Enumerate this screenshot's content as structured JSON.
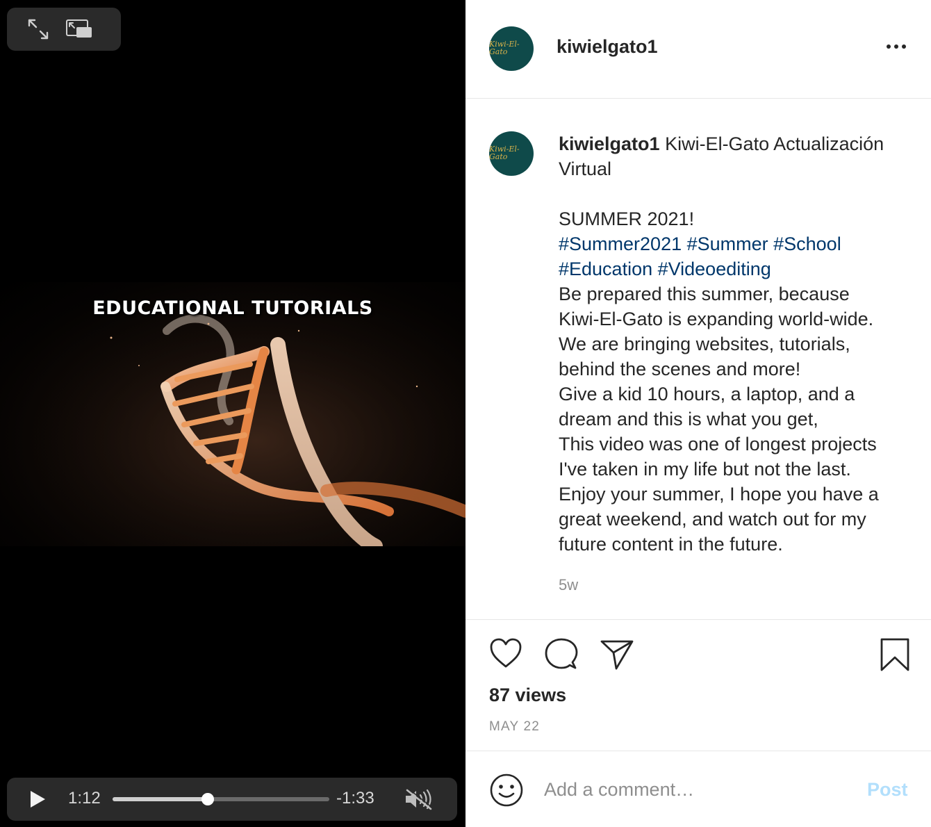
{
  "video": {
    "overlay_title": "Educational Tutorials",
    "time_elapsed": "1:12",
    "time_remaining": "-1:33",
    "progress_fraction": 0.44
  },
  "post": {
    "username": "kiwielgato1",
    "avatar_text": "Kiwi-El-Gato",
    "caption_title": "Kiwi-El-Gato Actualización",
    "caption_title_cont": "Virtual",
    "lines": [
      {
        "type": "text",
        "text": "SUMMER 2021!"
      },
      {
        "type": "tags",
        "text": "#Summer2021 #Summer #School"
      },
      {
        "type": "tags",
        "text": "#Education #Videoediting"
      },
      {
        "type": "text",
        "text": "Be prepared this summer, because"
      },
      {
        "type": "text",
        "text": "Kiwi-El-Gato is expanding world-wide."
      },
      {
        "type": "text",
        "text": "We are bringing websites, tutorials,"
      },
      {
        "type": "text",
        "text": "behind the scenes and more!"
      },
      {
        "type": "text",
        "text": "Give a kid 10 hours, a laptop, and a"
      },
      {
        "type": "text",
        "text": "dream and this is what you get,"
      },
      {
        "type": "text",
        "text": "This video was one of longest projects"
      },
      {
        "type": "text",
        "text": "I've taken in my life but not the last."
      },
      {
        "type": "text",
        "text": "Enjoy your summer, I hope you have a"
      },
      {
        "type": "text",
        "text": "great weekend, and watch out for my"
      },
      {
        "type": "text",
        "text": "future content in the future."
      }
    ],
    "age": "5w",
    "views": "87 views",
    "date": "MAY 22"
  },
  "comment": {
    "placeholder": "Add a comment…",
    "post_label": "Post"
  },
  "colors": {
    "hashtag": "#00376b",
    "post_button_disabled": "#b2dffc",
    "avatar_bg": "#0f4a4a"
  }
}
